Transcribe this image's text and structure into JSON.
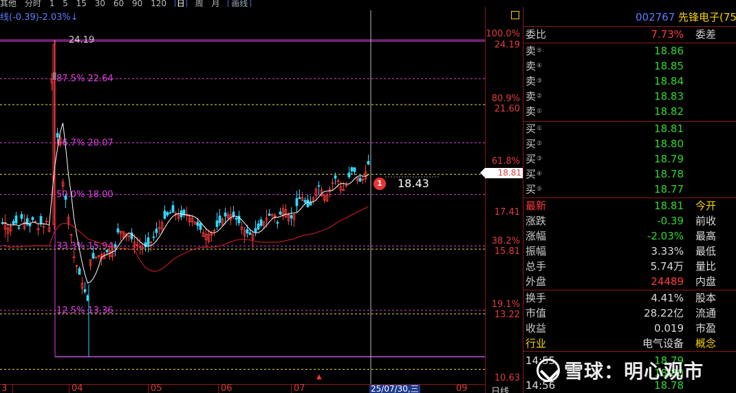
{
  "toolbar": {
    "items": [
      "其他",
      "分时",
      "1",
      "5",
      "15",
      "30",
      "60",
      "90",
      "120"
    ],
    "selected": "日",
    "after": [
      "周",
      "月"
    ],
    "button": "画线"
  },
  "indicator_text": "(-0.39)-2.03%↓",
  "fib_levels": [
    {
      "pct": "100.0%",
      "price": "24.19",
      "chart_label": "24.19"
    },
    {
      "pct": "87.5%",
      "price": "22.64",
      "chart_label": "87.5% 22.64"
    },
    {
      "pct": "80.9%",
      "price": "21.60",
      "chart_label": ""
    },
    {
      "pct": "66.7%",
      "price": "20.07",
      "chart_label": "66.7% 20.07"
    },
    {
      "pct": "61.8%",
      "price": "",
      "chart_label": ""
    },
    {
      "pct": "50.0%",
      "price": "18.00",
      "chart_label": "50.0% 18.00"
    },
    {
      "pct": "38.2%",
      "price": "15.81",
      "chart_label": ""
    },
    {
      "pct": "33.3%",
      "price": "15.94",
      "chart_label": "33.3% 15.94"
    },
    {
      "pct": "19.1%",
      "price": "13.22",
      "chart_label": ""
    },
    {
      "pct": "12.5%",
      "price": "13.36",
      "chart_label": "12.5% 13.36"
    }
  ],
  "axis": {
    "l100": "100.0%",
    "p100": "24.19",
    "l809": "80.9%",
    "p809": "21.60",
    "l618": "61.8%",
    "current": "18.81",
    "p1741": "17.41",
    "l382": "38.2%",
    "p382": "15.81",
    "l191": "19.1%",
    "p191": "13.22",
    "p1063": "10.63"
  },
  "chart_labels": {
    "top": "24.19",
    "f875": "87.5% 22.64",
    "f667": "66.7% 20.07",
    "f500": "50.0% 18.00",
    "f333": "33.3% 15.94",
    "f125": "12.5% 13.36"
  },
  "annotation": {
    "index": "1",
    "price": "18.43"
  },
  "bottom_axis": {
    "ticks": [
      "3",
      "04",
      "05",
      "06",
      "07",
      "09"
    ],
    "date": "25/07/30,三",
    "period": "日线"
  },
  "quote": {
    "code": "002767",
    "name": "先锋电子(75",
    "weibi_label": "委比",
    "weibi_value": "7.73%",
    "weicha_label": "委差",
    "sell": [
      {
        "label": "卖",
        "num": "⑤",
        "price": "18.86"
      },
      {
        "label": "卖",
        "num": "④",
        "price": "18.85"
      },
      {
        "label": "卖",
        "num": "③",
        "price": "18.84"
      },
      {
        "label": "卖",
        "num": "②",
        "price": "18.83"
      },
      {
        "label": "卖",
        "num": "①",
        "price": "18.82"
      }
    ],
    "buy": [
      {
        "label": "买",
        "num": "①",
        "price": "18.81"
      },
      {
        "label": "买",
        "num": "②",
        "price": "18.80"
      },
      {
        "label": "买",
        "num": "③",
        "price": "18.79"
      },
      {
        "label": "买",
        "num": "④",
        "price": "18.78"
      },
      {
        "label": "买",
        "num": "⑤",
        "price": "18.77"
      }
    ],
    "stats": [
      {
        "label": "最新",
        "value": "18.81",
        "vcolor": "green",
        "label2": "今开",
        "lcolor": "yellow"
      },
      {
        "label": "涨跌",
        "value": "-0.39",
        "vcolor": "green",
        "label2": "前收",
        "lcolor": "white"
      },
      {
        "label": "涨幅",
        "value": "-2.03%",
        "vcolor": "green",
        "label2": "最高",
        "lcolor": "white"
      },
      {
        "label": "振幅",
        "value": "3.33%",
        "vcolor": "white",
        "label2": "最低",
        "lcolor": "white"
      },
      {
        "label": "总手",
        "value": "5.74万",
        "vcolor": "white",
        "label2": "量比",
        "lcolor": "white"
      },
      {
        "label": "外盘",
        "value": "24489",
        "vcolor": "red",
        "label2": "内盘",
        "lcolor": "white"
      }
    ],
    "stats2": [
      {
        "label": "换手",
        "value": "4.41%",
        "vcolor": "white",
        "label2": "股本",
        "lcolor": "white"
      },
      {
        "label": "市值",
        "value": "28.22亿",
        "vcolor": "white",
        "label2": "流通",
        "lcolor": "white"
      },
      {
        "label": "收益",
        "value": "0.019",
        "vcolor": "white",
        "label2": "市盈",
        "lcolor": "white"
      },
      {
        "label": "行业",
        "value": "电气设备",
        "vcolor": "white",
        "label2": "概念",
        "lcolor": "yellow"
      }
    ],
    "ticks": [
      {
        "time": "14:55",
        "price": "18.79"
      },
      {
        "time": "",
        "price": "18.80"
      },
      {
        "time": "14:56",
        "price": "18.78"
      }
    ]
  },
  "watermark": "雪球：明心观市",
  "colors": {
    "up": "#ff3b3b",
    "down": "#2fd8ff",
    "fib": "#e040e0",
    "ma_white": "#ffffff",
    "ma_red": "#e02020"
  }
}
